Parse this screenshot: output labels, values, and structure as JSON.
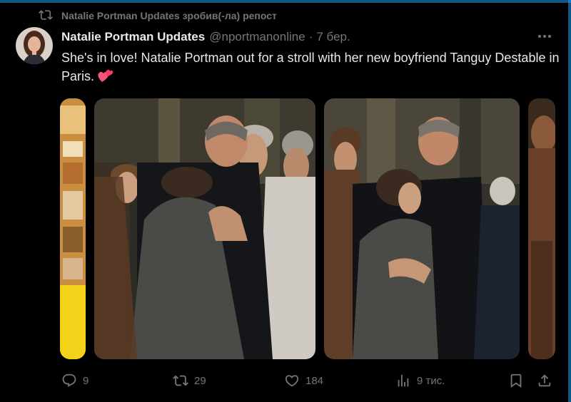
{
  "repost_banner": {
    "icon": "repost-icon",
    "text": "Natalie Portman Updates зробив(-ла) репост"
  },
  "tweet": {
    "display_name": "Natalie Portman Updates",
    "handle": "@nportmanonline",
    "separator": "·",
    "time": "7 бер.",
    "text": "She's in love! Natalie Portman out for a stroll with her new boyfriend Tanguy Destable in Paris.",
    "emoji": "heart-emoji",
    "media_count": 4,
    "actions": {
      "replies": "9",
      "reposts": "29",
      "likes": "184",
      "views": "9 тис."
    }
  },
  "colors": {
    "background": "#000000",
    "text_primary": "#e7e9ea",
    "text_secondary": "#71767b",
    "accent": "#1d9bf0",
    "emoji_pink": "#f4577a"
  }
}
